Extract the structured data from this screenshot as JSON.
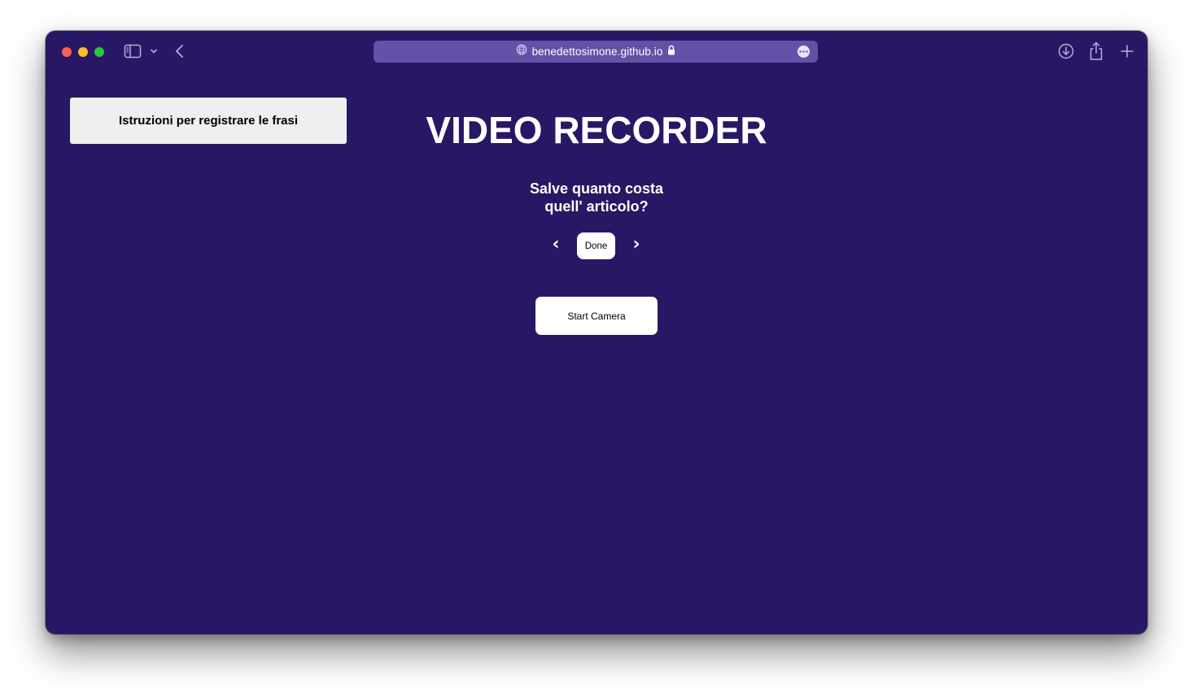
{
  "browser": {
    "url": "benedettosimone.github.io",
    "accent": "#6550a8",
    "background": "#281764"
  },
  "page": {
    "instructions_button": "Istruzioni per registrare le frasi",
    "title": "VIDEO RECORDER",
    "phrase_line1": "Salve quanto costa",
    "phrase_line2": "quell' articolo?",
    "prev_arrow": "‹",
    "next_arrow": "›",
    "done_button": "Done",
    "start_camera_button": "Start Camera"
  },
  "icons": [
    "close-window-icon",
    "minimize-window-icon",
    "zoom-window-icon",
    "sidebar-icon",
    "chevron-down-icon",
    "back-icon",
    "globe-icon",
    "lock-icon",
    "more-icon",
    "download-icon",
    "share-icon",
    "plus-icon"
  ]
}
